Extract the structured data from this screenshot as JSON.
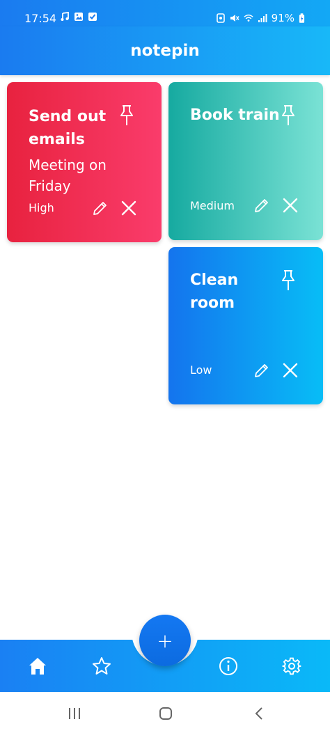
{
  "status_bar": {
    "time": "17:54",
    "battery": "91%",
    "left_icons": [
      "music-note-icon",
      "image-icon",
      "checkbox-icon"
    ],
    "right_icons": [
      "alarm-icon",
      "mute-icon",
      "wifi-icon",
      "signal-icon",
      "battery-icon"
    ]
  },
  "app": {
    "title": "notepin"
  },
  "notes": [
    {
      "title_lines": [
        "Send out",
        "emails"
      ],
      "body_lines": [
        "Meeting on",
        "Friday"
      ],
      "priority": "High",
      "color_start": "#e8223f",
      "color_end": "#fa3c6b"
    },
    {
      "title_lines": [
        "Book train"
      ],
      "body_lines": [],
      "priority": "Medium",
      "color_start": "#16aaa0",
      "color_end": "#7ae2d5"
    },
    {
      "title_lines": [
        "Clean",
        "room"
      ],
      "body_lines": [],
      "priority": "Low",
      "color_start": "#1474ee",
      "color_end": "#08bdf6"
    }
  ],
  "bottom_nav": {
    "items": [
      "home-icon",
      "star-icon",
      "info-icon",
      "gear-icon"
    ],
    "fab_label": "+"
  },
  "system_nav": [
    "recents-icon",
    "home-button-icon",
    "back-icon"
  ]
}
